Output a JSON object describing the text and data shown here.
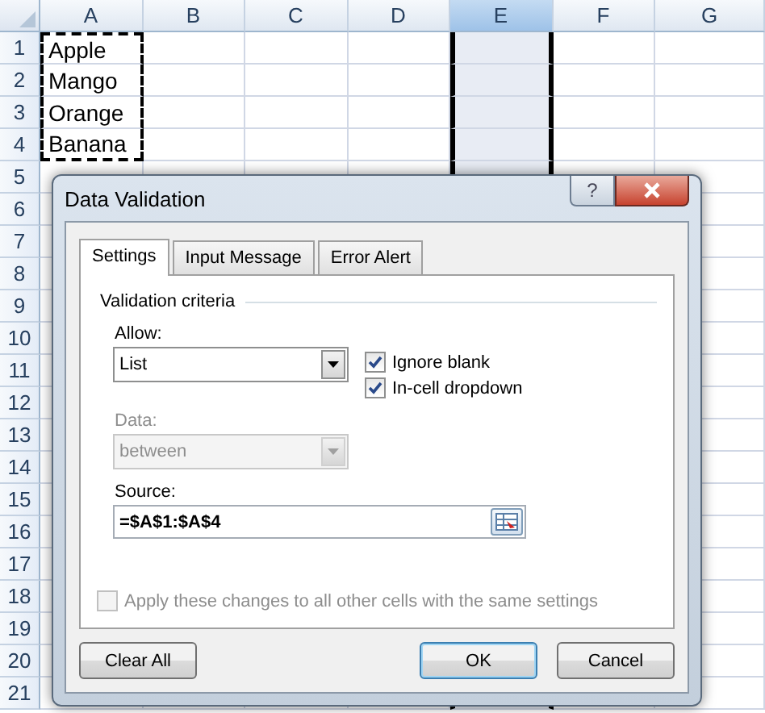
{
  "columns": [
    {
      "label": "A",
      "selected": false
    },
    {
      "label": "B",
      "selected": false
    },
    {
      "label": "C",
      "selected": false
    },
    {
      "label": "D",
      "selected": false
    },
    {
      "label": "E",
      "selected": true
    },
    {
      "label": "F",
      "selected": false
    },
    {
      "label": "G",
      "selected": false
    }
  ],
  "rows": [
    {
      "number": "1",
      "cells": [
        "Apple"
      ],
      "copied": true
    },
    {
      "number": "2",
      "cells": [
        "Mango"
      ],
      "copied": true
    },
    {
      "number": "3",
      "cells": [
        "Orange"
      ],
      "copied": true
    },
    {
      "number": "4",
      "cells": [
        "Banana"
      ],
      "copied": true
    },
    {
      "number": "5",
      "cells": [],
      "copied": false
    },
    {
      "number": "6",
      "cells": [],
      "copied": false
    },
    {
      "number": "7",
      "cells": [],
      "copied": false
    },
    {
      "number": "8",
      "cells": [],
      "copied": false
    },
    {
      "number": "9",
      "cells": [],
      "copied": false
    },
    {
      "number": "10",
      "cells": [],
      "copied": false
    },
    {
      "number": "11",
      "cells": [],
      "copied": false
    },
    {
      "number": "12",
      "cells": [],
      "copied": false
    },
    {
      "number": "13",
      "cells": [],
      "copied": false
    },
    {
      "number": "14",
      "cells": [],
      "copied": false
    },
    {
      "number": "15",
      "cells": [],
      "copied": false
    },
    {
      "number": "16",
      "cells": [],
      "copied": false
    },
    {
      "number": "17",
      "cells": [],
      "copied": false
    },
    {
      "number": "18",
      "cells": [],
      "copied": false
    },
    {
      "number": "19",
      "cells": [],
      "copied": false
    },
    {
      "number": "20",
      "cells": [],
      "copied": false
    },
    {
      "number": "21",
      "cells": [],
      "copied": false
    }
  ],
  "dialog": {
    "title": "Data Validation",
    "help_button": "?",
    "tabs": [
      {
        "label": "Settings",
        "selected": true
      },
      {
        "label": "Input Message",
        "selected": false
      },
      {
        "label": "Error Alert",
        "selected": false
      }
    ],
    "section_title": "Validation criteria",
    "allow": {
      "label": "Allow:",
      "value": "List",
      "disabled": false
    },
    "data": {
      "label": "Data:",
      "value": "between",
      "disabled": true
    },
    "options": [
      {
        "label": "Ignore blank",
        "checked": true
      },
      {
        "label": "In-cell dropdown",
        "checked": true
      }
    ],
    "source": {
      "label": "Source:",
      "value": "=$A$1:$A$4"
    },
    "apply_all": {
      "label": "Apply these changes to all other cells with the same settings",
      "checked": false,
      "disabled": true
    },
    "buttons": [
      {
        "label": "Clear All",
        "default": false
      },
      {
        "label": "OK",
        "default": true
      },
      {
        "label": "Cancel",
        "default": false
      }
    ]
  }
}
